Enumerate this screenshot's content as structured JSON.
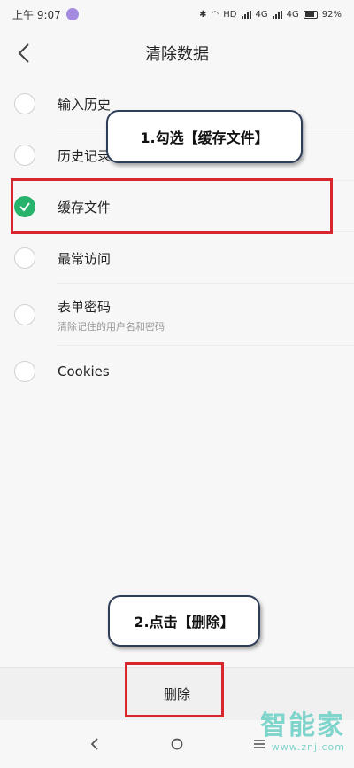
{
  "status_bar": {
    "time": "上午 9:07",
    "network_hd": "HD",
    "network_4g_1": "4G",
    "network_4g_2": "4G",
    "battery": "92%"
  },
  "header": {
    "title": "清除数据"
  },
  "options": [
    {
      "label": "输入历史",
      "sub": "",
      "checked": false
    },
    {
      "label": "历史记录",
      "sub": "",
      "checked": false
    },
    {
      "label": "缓存文件",
      "sub": "",
      "checked": true
    },
    {
      "label": "最常访问",
      "sub": "",
      "checked": false
    },
    {
      "label": "表单密码",
      "sub": "清除记住的用户名和密码",
      "checked": false
    },
    {
      "label": "Cookies",
      "sub": "",
      "checked": false
    }
  ],
  "annotations": {
    "callout_1": "1.勾选【缓存文件】",
    "callout_2": "2.点击【删除】"
  },
  "action_bar": {
    "delete_label": "删除"
  },
  "watermark": {
    "logo": "智能家",
    "url": "www.znj.com"
  },
  "colors": {
    "check_green": "#27b36b",
    "highlight_red": "#d8262f",
    "callout_border": "#2e3d58",
    "watermark": "#7fd4cc"
  }
}
